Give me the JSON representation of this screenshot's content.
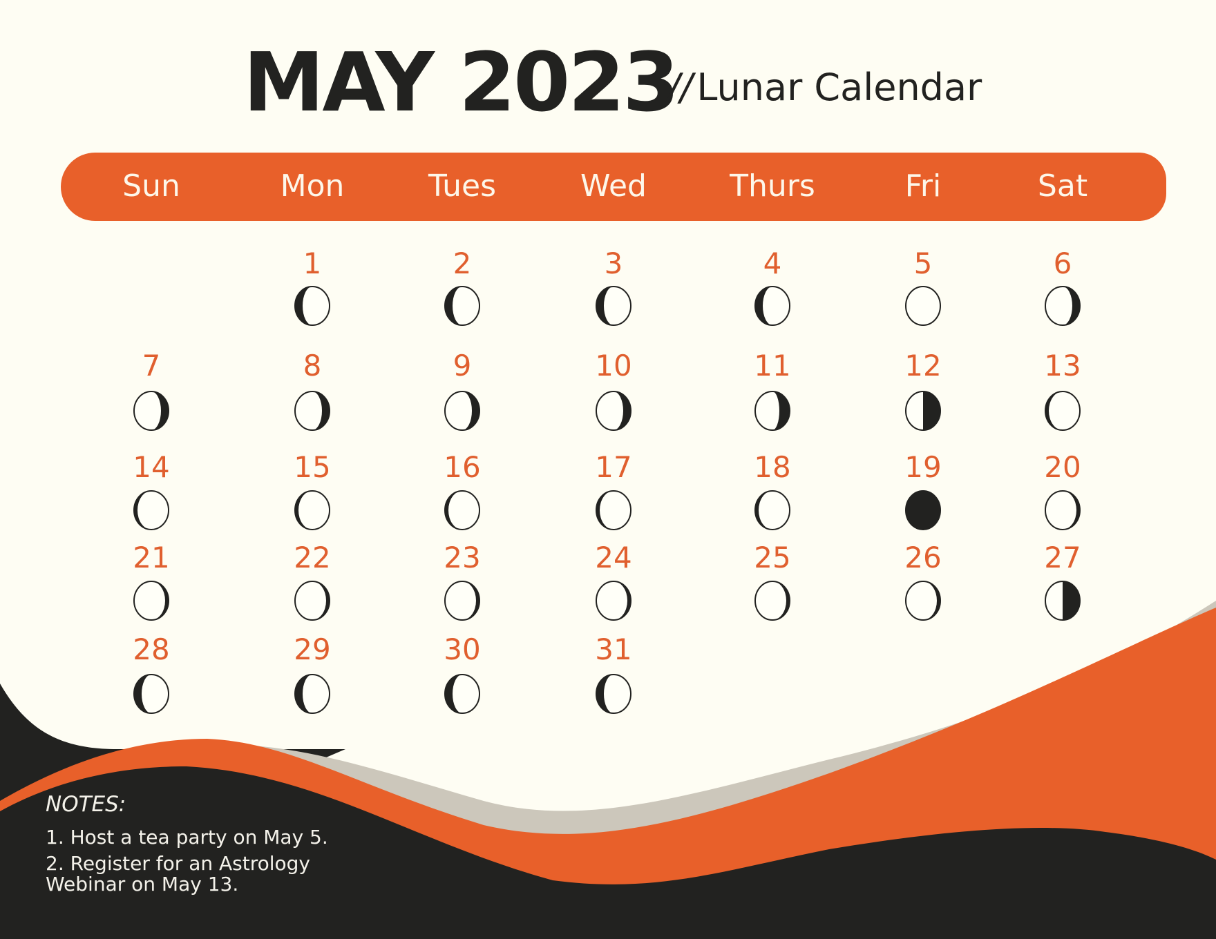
{
  "header": {
    "month_year": "MAY 2023",
    "separator": "//",
    "subtitle": "Lunar Calendar"
  },
  "weekdays": [
    "Sun",
    "Mon",
    "Tues",
    "Wed",
    "Thurs",
    "Fri",
    "Sat"
  ],
  "calendar": {
    "month": "May",
    "year": 2023,
    "first_weekday_index": 1,
    "days": [
      {
        "day": "1",
        "phase": "dark-left-crescent"
      },
      {
        "day": "2",
        "phase": "dark-left-crescent"
      },
      {
        "day": "3",
        "phase": "dark-left-crescent"
      },
      {
        "day": "4",
        "phase": "dark-left-crescent"
      },
      {
        "day": "5",
        "phase": "full-empty"
      },
      {
        "day": "6",
        "phase": "dark-right-crescent"
      },
      {
        "day": "7",
        "phase": "dark-right-crescent"
      },
      {
        "day": "8",
        "phase": "dark-right-crescent"
      },
      {
        "day": "9",
        "phase": "dark-right-crescent"
      },
      {
        "day": "10",
        "phase": "dark-right-crescent"
      },
      {
        "day": "11",
        "phase": "dark-right-crescent-wide"
      },
      {
        "day": "12",
        "phase": "half-right-dark"
      },
      {
        "day": "13",
        "phase": "dark-left-thin"
      },
      {
        "day": "14",
        "phase": "dark-left-thin"
      },
      {
        "day": "15",
        "phase": "dark-left-thin"
      },
      {
        "day": "16",
        "phase": "dark-left-thin"
      },
      {
        "day": "17",
        "phase": "dark-left-thin"
      },
      {
        "day": "18",
        "phase": "dark-left-thin"
      },
      {
        "day": "19",
        "phase": "full-dark"
      },
      {
        "day": "20",
        "phase": "dark-right-thin"
      },
      {
        "day": "21",
        "phase": "dark-right-thin"
      },
      {
        "day": "22",
        "phase": "dark-right-thin"
      },
      {
        "day": "23",
        "phase": "dark-right-thin"
      },
      {
        "day": "24",
        "phase": "dark-right-thin"
      },
      {
        "day": "25",
        "phase": "dark-right-thin"
      },
      {
        "day": "26",
        "phase": "dark-right-thin"
      },
      {
        "day": "27",
        "phase": "half-right-dark"
      },
      {
        "day": "28",
        "phase": "dark-left-crescent"
      },
      {
        "day": "29",
        "phase": "dark-left-crescent"
      },
      {
        "day": "30",
        "phase": "dark-left-crescent"
      },
      {
        "day": "31",
        "phase": "dark-left-crescent"
      }
    ]
  },
  "notes": {
    "title": "NOTES:",
    "items": [
      [
        "1. Host a tea party on May 5."
      ],
      [
        "2. Register for an Astrology",
        "Webinar on May 13."
      ]
    ]
  },
  "colors": {
    "background": "#fefdf3",
    "accent_orange": "#e8602a",
    "day_number_orange": "#e05f2e",
    "dark": "#222220",
    "beige_wave": "#ccc7bb"
  }
}
